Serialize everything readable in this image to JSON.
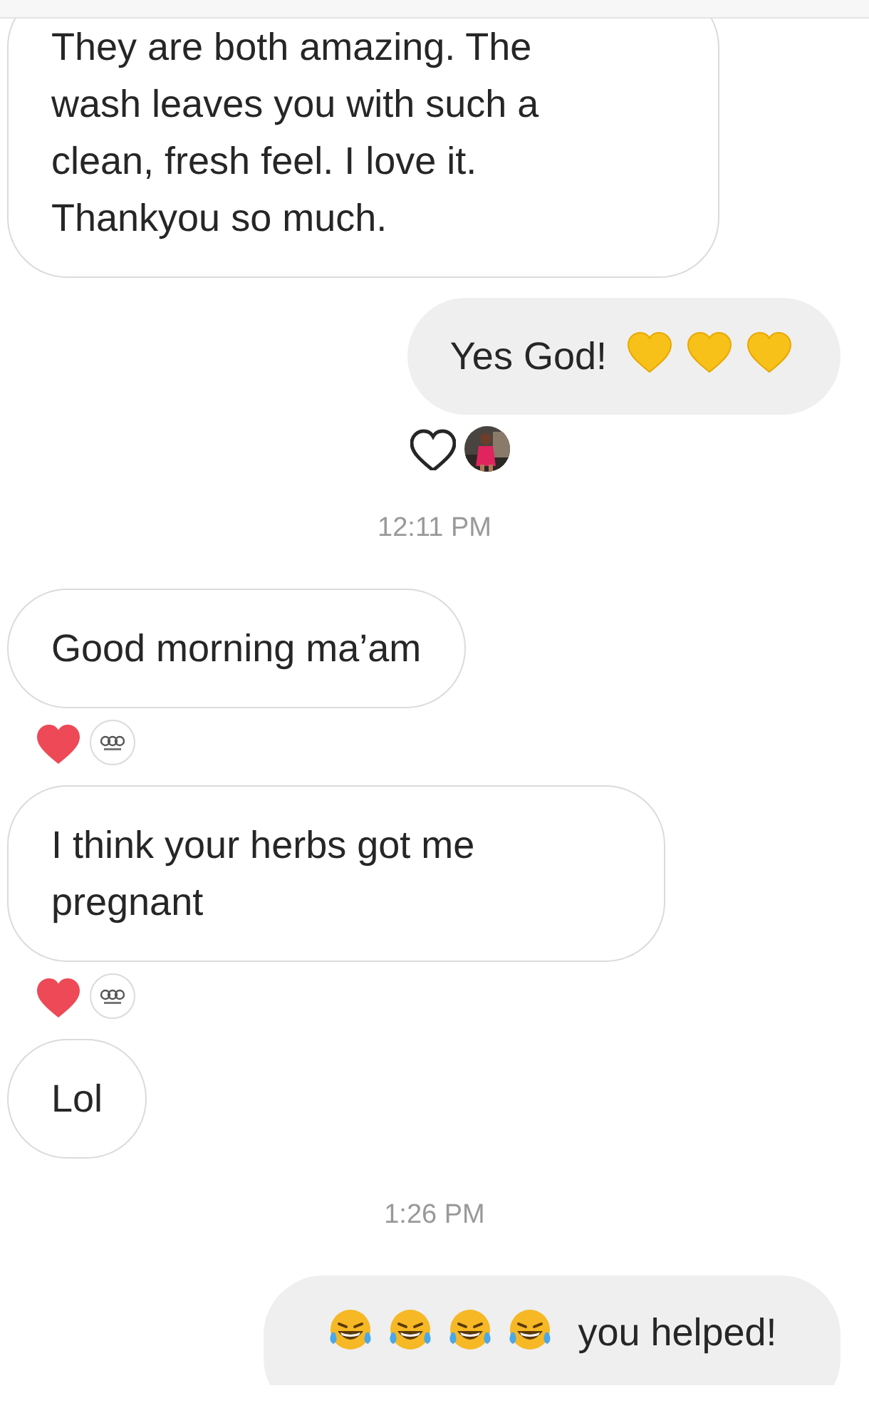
{
  "messages": [
    {
      "kind": "message",
      "outgoing": false,
      "parts": [
        {
          "kind": "text",
          "text": "They are both amazing. The wash leaves you with such a clean, fresh feel. I love it. Thankyou so much."
        }
      ]
    },
    {
      "kind": "message",
      "outgoing": true,
      "parts": [
        {
          "kind": "text",
          "text": "Yes God!"
        },
        {
          "kind": "heart"
        },
        {
          "kind": "heart"
        },
        {
          "kind": "heart"
        }
      ],
      "reactions": {
        "liked": false
      }
    },
    {
      "kind": "timestamp",
      "text": "12:11 PM"
    },
    {
      "kind": "message",
      "outgoing": false,
      "parts": [
        {
          "kind": "text",
          "text": "Good morning ma’am"
        }
      ],
      "reactions": {
        "liked": true,
        "reactors": [
          {
            "kind": "logo"
          }
        ]
      }
    },
    {
      "kind": "message",
      "outgoing": false,
      "parts": [
        {
          "kind": "text",
          "text": "I think your herbs got me pregnant"
        }
      ],
      "reactions": {
        "liked": true,
        "reactors": [
          {
            "kind": "logo"
          }
        ]
      }
    },
    {
      "kind": "message",
      "outgoing": false,
      "parts": [
        {
          "kind": "text",
          "text": "Lol"
        }
      ]
    },
    {
      "kind": "timestamp",
      "text": "1:26 PM"
    },
    {
      "kind": "message",
      "outgoing": true,
      "parts": [
        {
          "kind": "laugh"
        },
        {
          "kind": "laugh"
        },
        {
          "kind": "laugh"
        },
        {
          "kind": "laugh"
        },
        {
          "kind": "text",
          "text": "you helped!"
        }
      ]
    }
  ]
}
